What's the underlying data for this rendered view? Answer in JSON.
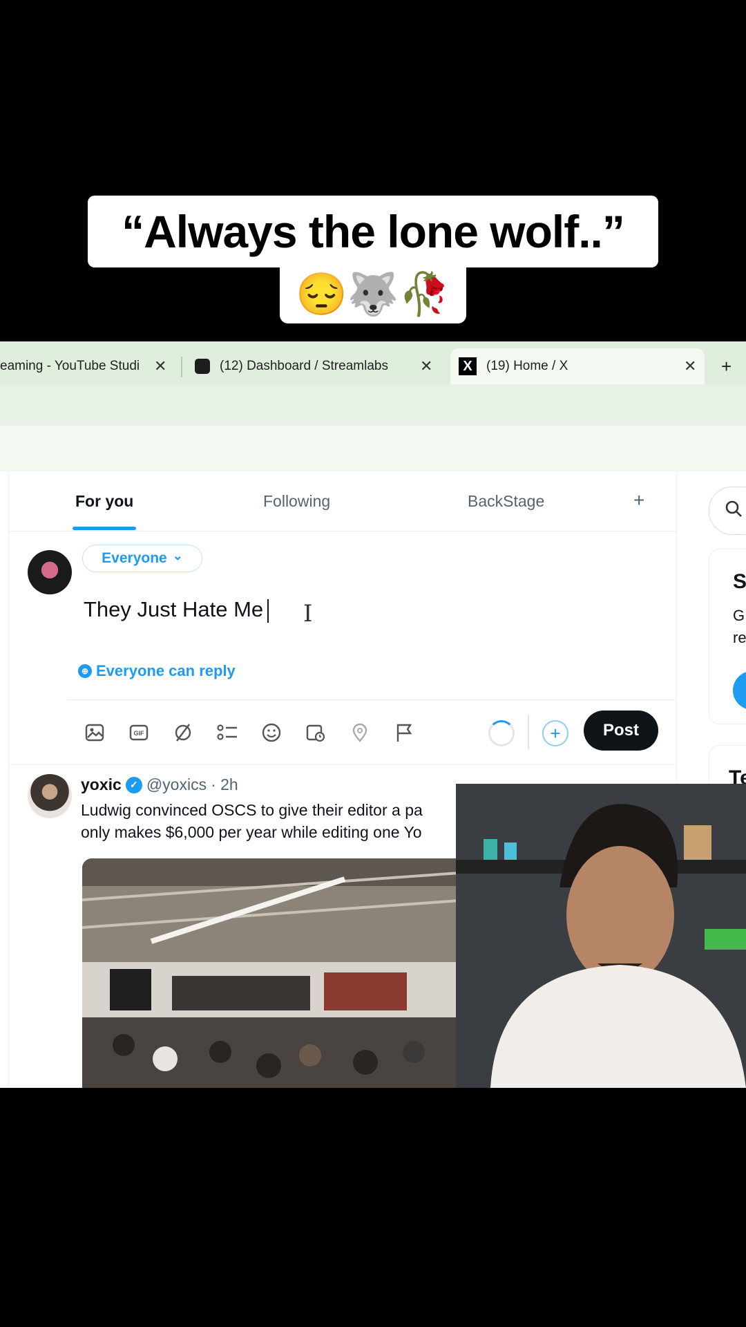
{
  "caption": {
    "line1": "“Always the lone wolf..”",
    "line2": "😔🐺🥀"
  },
  "browser": {
    "tabs": [
      {
        "title": "eaming - YouTube Studi",
        "close": "✕"
      },
      {
        "title": "(12) Dashboard / Streamlabs",
        "close": "✕"
      },
      {
        "title": "(19) Home / X",
        "close": "✕",
        "active": true
      }
    ],
    "new_tab": "+"
  },
  "feed_tabs": {
    "for_you": "For you",
    "following": "Following",
    "backstage": "BackStage",
    "add": "+"
  },
  "composer": {
    "audience": "Everyone",
    "audience_chevron": "⌄",
    "text": "They Just Hate Me",
    "reply_setting": "Everyone can reply",
    "post_button": "Post",
    "add_button": "+"
  },
  "tweet": {
    "name": "yoxic",
    "handle": "@yoxics",
    "time": "· 2h",
    "line1": "Ludwig convinced OSCS to give their editor a pa",
    "line2": "only makes $6,000 per year while editing one Yo"
  },
  "sidebar": {
    "card_heading": "S",
    "card_text_1": "G",
    "card_text_2": "re",
    "trends_heading": "Te"
  },
  "icons": {
    "search": "🔍",
    "ibeam": "I",
    "verified": "✓",
    "globe": "🌐"
  },
  "colors": {
    "accent": "#1d9bf0",
    "post_button": "#0f1419",
    "tab_bar": "#dfeedd"
  }
}
